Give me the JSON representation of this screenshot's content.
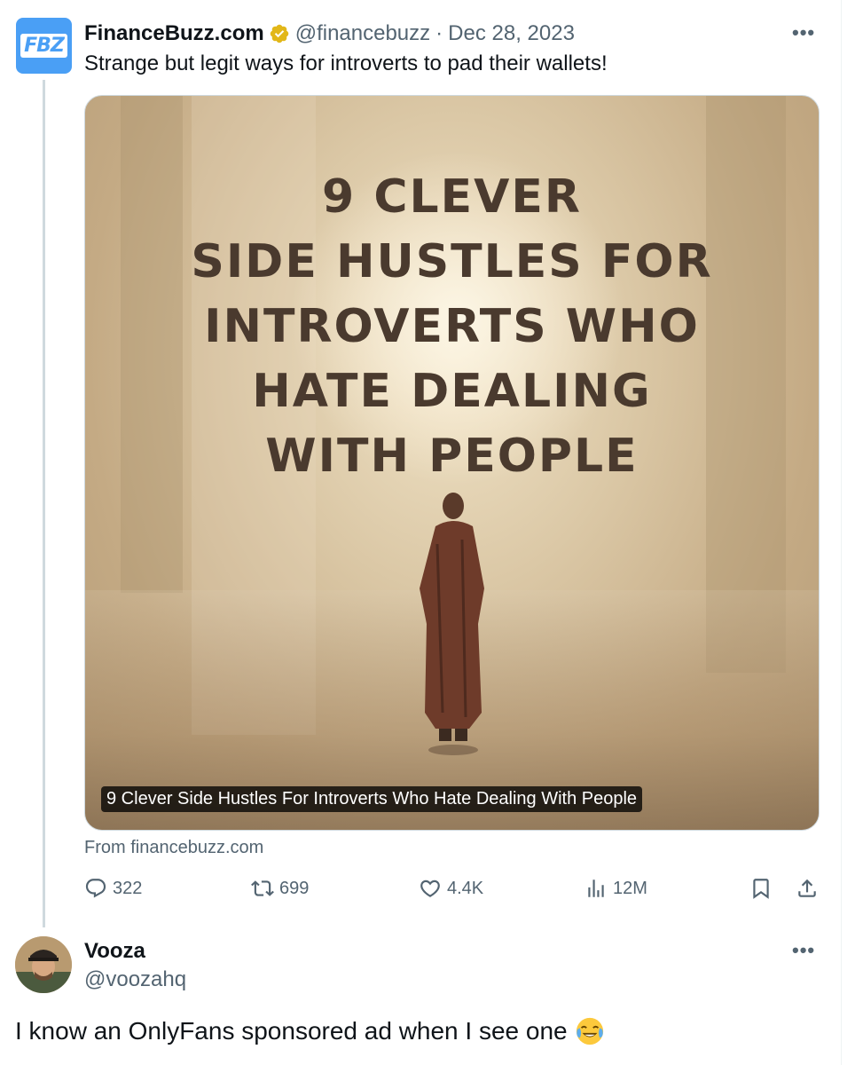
{
  "tweet": {
    "author_name": "FinanceBuzz.com",
    "handle": "@financebuzz",
    "separator": "·",
    "date": "Dec 28, 2023",
    "avatar_text": "FBZ",
    "text": "Strange but legit ways for introverts to pad their wallets!",
    "more_label": "•••",
    "media": {
      "headline_lines": [
        "9 CLEVER",
        "SIDE HUSTLES FOR",
        "INTROVERTS WHO",
        "HATE DEALING",
        "WITH PEOPLE"
      ],
      "caption": "9 Clever Side Hustles For Introverts Who Hate Dealing With People"
    },
    "source": "From financebuzz.com",
    "actions": {
      "replies": "322",
      "reposts": "699",
      "likes": "4.4K",
      "views": "12M"
    }
  },
  "reply": {
    "author_name": "Vooza",
    "handle": "@voozahq",
    "more_label": "•••",
    "text": "I know an OnlyFans sponsored ad when I see one"
  },
  "icons": {
    "verified": "verified-badge-icon",
    "reply": "reply-icon",
    "repost": "repost-icon",
    "like": "heart-icon",
    "views": "views-icon",
    "bookmark": "bookmark-icon",
    "share": "share-icon",
    "emoji": "tears-of-joy-emoji"
  },
  "colors": {
    "accent": "#1d9bf0",
    "verified_gold": "#e2b719",
    "muted_text": "#536471",
    "brand_blue": "#4a9ff5"
  }
}
